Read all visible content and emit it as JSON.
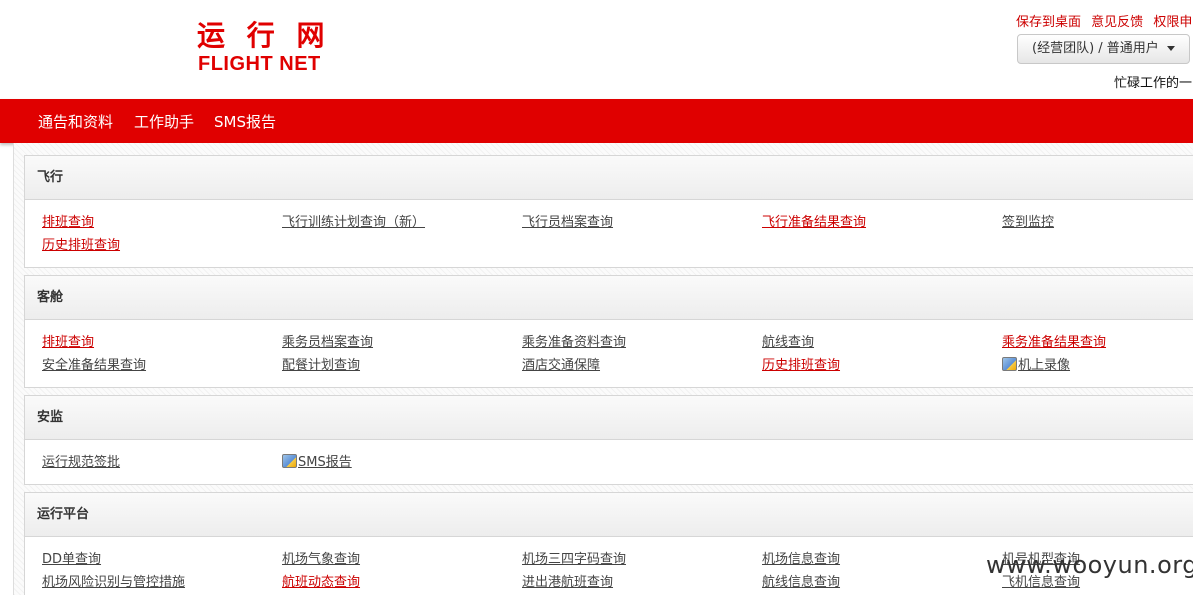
{
  "logo": {
    "cn": "运 行 网",
    "en": "FLIGHT NET"
  },
  "top_links": [
    "保存到桌面",
    "意见反馈",
    "权限申"
  ],
  "user_menu": {
    "label": "(经营团队) / 普通用户"
  },
  "marquee": "忙碌工作的一",
  "nav": [
    "通告和资料",
    "工作助手",
    "SMS报告"
  ],
  "sections": [
    {
      "title": "飞行",
      "links": [
        {
          "label": "排班查询",
          "red": true
        },
        {
          "label": "飞行训练计划查询（新）",
          "red": false
        },
        {
          "label": "飞行员档案查询",
          "red": false
        },
        {
          "label": "飞行准备结果查询",
          "red": true
        },
        {
          "label": "签到监控",
          "red": false
        },
        {
          "label": "历史排班查询",
          "red": true
        }
      ]
    },
    {
      "title": "客舱",
      "links": [
        {
          "label": "排班查询",
          "red": true
        },
        {
          "label": "乘务员档案查询",
          "red": false
        },
        {
          "label": "乘务准备资料查询",
          "red": false
        },
        {
          "label": "航线查询",
          "red": false
        },
        {
          "label": "乘务准备结果查询",
          "red": true
        },
        {
          "label": "安全准备结果查询",
          "red": false
        },
        {
          "label": "配餐计划查询",
          "red": false
        },
        {
          "label": "酒店交通保障",
          "red": false
        },
        {
          "label": "历史排班查询",
          "red": true
        },
        {
          "label": "机上录像",
          "red": false,
          "icon": "video-icon"
        }
      ]
    },
    {
      "title": "安监",
      "links": [
        {
          "label": "运行规范签批",
          "red": false
        },
        {
          "label": "SMS报告",
          "red": false,
          "icon": "report-icon"
        }
      ]
    },
    {
      "title": "运行平台",
      "links": [
        {
          "label": "DD单查询",
          "red": false
        },
        {
          "label": "机场气象查询",
          "red": false
        },
        {
          "label": "机场三四字码查询",
          "red": false
        },
        {
          "label": "机场信息查询",
          "red": false
        },
        {
          "label": "机号机型查询",
          "red": false
        },
        {
          "label": "机场风险识别与管控措施",
          "red": false
        },
        {
          "label": "航班动态查询",
          "red": true
        },
        {
          "label": "进出港航班查询",
          "red": false
        },
        {
          "label": "航线信息查询",
          "red": false
        },
        {
          "label": "飞机信息查询",
          "red": false
        }
      ]
    }
  ],
  "watermark": "www.wooyun.org",
  "colors": {
    "brand_red": "#e00000",
    "link_red": "#cc0000",
    "link_gray": "#444444"
  }
}
